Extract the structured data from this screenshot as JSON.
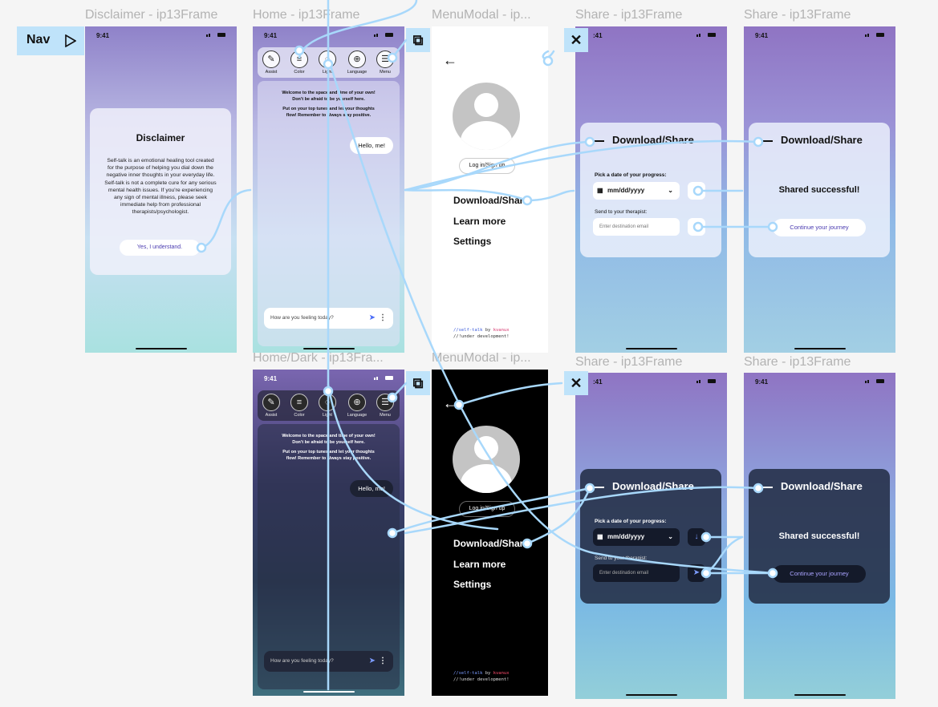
{
  "frames": {
    "disclaimer": {
      "label": "Disclaimer - ip13Frame"
    },
    "home": {
      "label": "Home - ip13Frame"
    },
    "menu": {
      "label": "MenuModal - ip..."
    },
    "share1": {
      "label": "Share - ip13Frame"
    },
    "share2": {
      "label": "Share - ip13Frame"
    },
    "home_dark": {
      "label": "Home/Dark - ip13Fra..."
    },
    "menu_dark": {
      "label": "MenuModal - ip..."
    },
    "share3": {
      "label": "Share - ip13Frame"
    },
    "share4": {
      "label": "Share - ip13Frame"
    }
  },
  "nav": {
    "label": "Nav",
    "play_icon": "play-triangle-icon"
  },
  "status": {
    "time": "9:41"
  },
  "disclaimer": {
    "title": "Disclaimer",
    "body": "Self-talk is an emotional healing tool created for the purpose of helping you dial down the negative inner thoughts in your everyday life. Self-talk is not a complete cure for any serious mental health issues. If you're experiencing any sign of mental illness, please seek immediate help from professional therapists/psychologist.",
    "button": "Yes, I understand."
  },
  "home": {
    "tools": [
      {
        "label": "Assist",
        "icon": "assist-icon"
      },
      {
        "label": "Color",
        "icon": "sliders-icon"
      },
      {
        "label": "Light",
        "icon": "bulb-icon"
      },
      {
        "label": "Language",
        "icon": "globe-icon"
      },
      {
        "label": "Menu",
        "icon": "menu-icon"
      }
    ],
    "welcome_line1": "Welcome to the space and time of your own!",
    "welcome_line2": "Don't be afraid to be yourself here.",
    "welcome_line3": "Put on your top tunes and let your thoughts",
    "welcome_line4": "flow! Remember to always stay positive.",
    "bubble": "Hello, me!",
    "input_placeholder": "How are you feeling today?"
  },
  "menu": {
    "back": "←",
    "login": "Log in/Sign up",
    "items": [
      "Download/Share",
      "Learn more",
      "Settings"
    ],
    "code_line1_prefix": "//self-talk",
    "code_line1_by": " by ",
    "code_line1_author": "kvanux",
    "code_line2": "//!under development!"
  },
  "share": {
    "title": "Download/Share",
    "pick_label": "Pick a date of your progress:",
    "date_placeholder": "mm/dd/yyyy",
    "send_label": "Send to your therapist:",
    "email_placeholder": "Enter destination email",
    "success": "Shared successful!",
    "continue": "Continue your journey"
  },
  "colors": {
    "accent": "#4a6cf7",
    "wire": "#a8d8fb",
    "connector_bg": "#bfe3fa"
  }
}
